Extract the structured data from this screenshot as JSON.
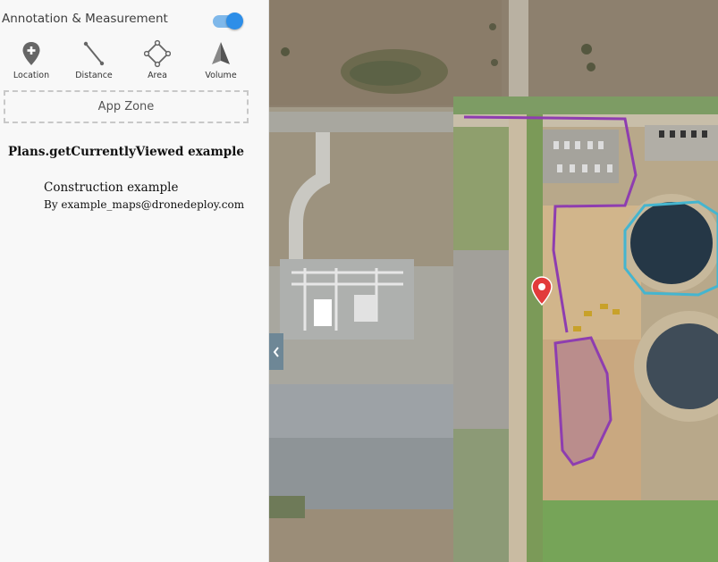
{
  "panel": {
    "title": "Annotation & Measurement",
    "toggle_on": true,
    "accent_color": "#2d8ee8",
    "tools": [
      {
        "label": "Location",
        "icon": "location-pin-icon"
      },
      {
        "label": "Distance",
        "icon": "distance-line-icon"
      },
      {
        "label": "Area",
        "icon": "area-polygon-icon"
      },
      {
        "label": "Volume",
        "icon": "volume-pyramid-icon"
      }
    ],
    "app_zone_label": "App Zone"
  },
  "plans": {
    "heading": "Plans.getCurrentlyViewed example",
    "plan_name": "Construction example",
    "plan_author": "By example_maps@dronedeploy.com"
  },
  "map": {
    "annotation_colors": {
      "line": "#8e3db0",
      "area": "#8e3db0",
      "volume": "#45b5cf",
      "marker": "#e23b3b"
    },
    "collapse_icon": "chevron-left-icon"
  }
}
